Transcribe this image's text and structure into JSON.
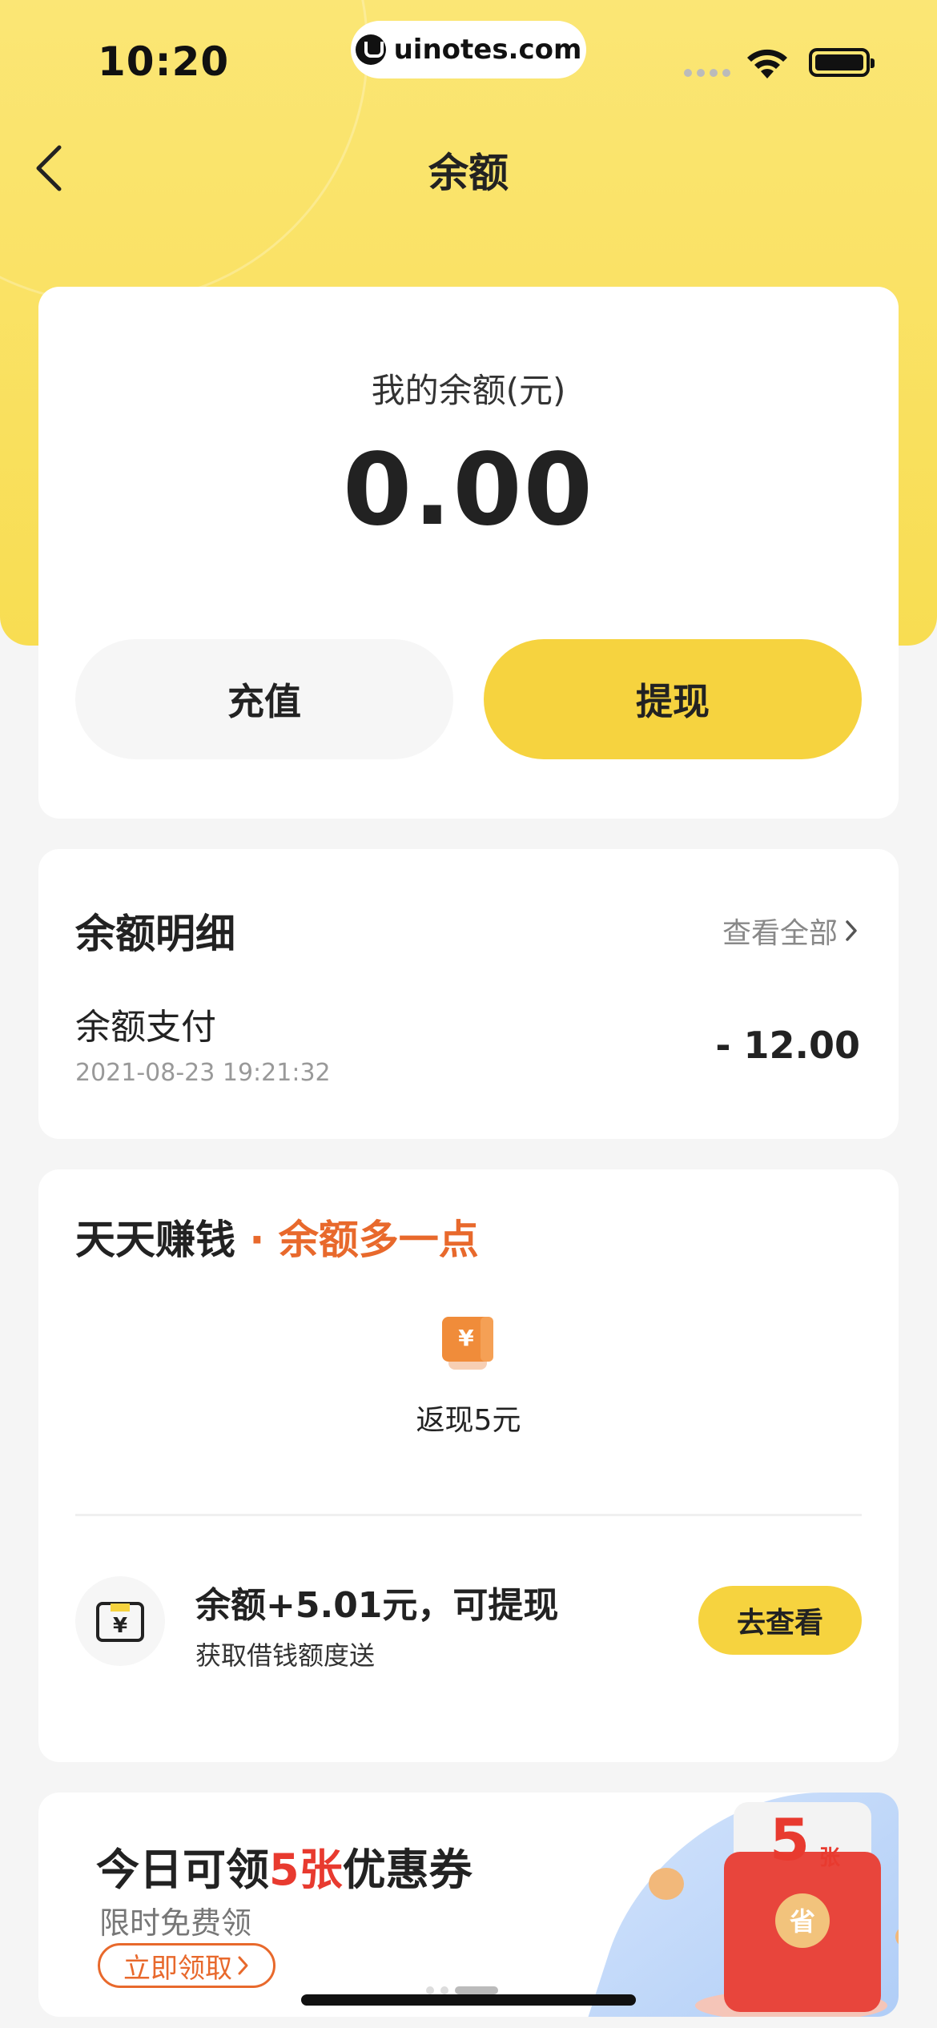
{
  "status_bar": {
    "time": "10:20",
    "url": "uinotes.com"
  },
  "nav": {
    "title": "余额"
  },
  "balance": {
    "label": "我的余额(元)",
    "value": "0.00",
    "recharge_label": "充值",
    "withdraw_label": "提现"
  },
  "details": {
    "title": "余额明细",
    "view_all": "查看全部",
    "transactions": [
      {
        "name": "余额支付",
        "time": "2021-08-23 19:21:32",
        "amount": "- 12.00"
      }
    ]
  },
  "earn": {
    "title": "天天赚钱",
    "subtitle": " · 余额多一点",
    "cashback_label": "返现5元",
    "offer_title": "余额+5.01元，可提现",
    "offer_sub": "获取借钱额度送",
    "offer_button": "去查看"
  },
  "coupon_banner": {
    "title_pre": "今日可领",
    "title_highlight": "5张",
    "title_post": "优惠券",
    "sub": "限时免费领",
    "button": "立即领取",
    "envelope_count": "5",
    "envelope_unit": "张",
    "envelope_seal": "省"
  },
  "colors": {
    "accent": "#f6d33f",
    "orange": "#e8692c",
    "red": "#e83a2f"
  },
  "icons": [
    "back-icon",
    "wifi-icon",
    "battery-icon",
    "chevron-right-icon",
    "cashback-icon",
    "yuan-card-icon"
  ]
}
